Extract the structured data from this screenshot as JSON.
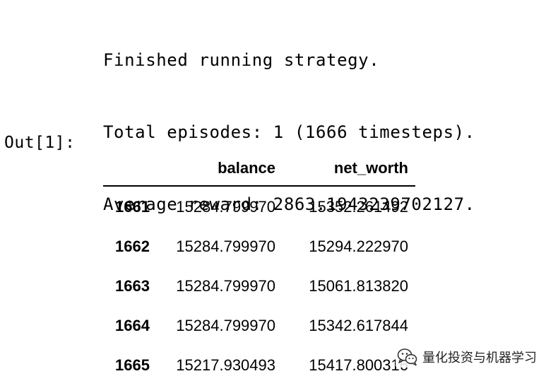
{
  "stdout": {
    "lines": [
      "Finished running strategy.",
      "Total episodes: 1 (1666 timesteps).",
      "Average reward: 2863.1943239702127."
    ]
  },
  "output": {
    "prompt": "Out[1]:"
  },
  "dataframe": {
    "columns": [
      "balance",
      "net_worth"
    ],
    "rows": [
      {
        "index": "1661",
        "balance": "15284.799970",
        "net_worth": "15352.261492"
      },
      {
        "index": "1662",
        "balance": "15284.799970",
        "net_worth": "15294.222970"
      },
      {
        "index": "1663",
        "balance": "15284.799970",
        "net_worth": "15061.813820"
      },
      {
        "index": "1664",
        "balance": "15284.799970",
        "net_worth": "15342.617844"
      },
      {
        "index": "1665",
        "balance": "15217.930493",
        "net_worth": "15417.800316"
      }
    ]
  },
  "watermark": {
    "icon": "wechat-icon",
    "text": "量化投资与机器学习"
  }
}
